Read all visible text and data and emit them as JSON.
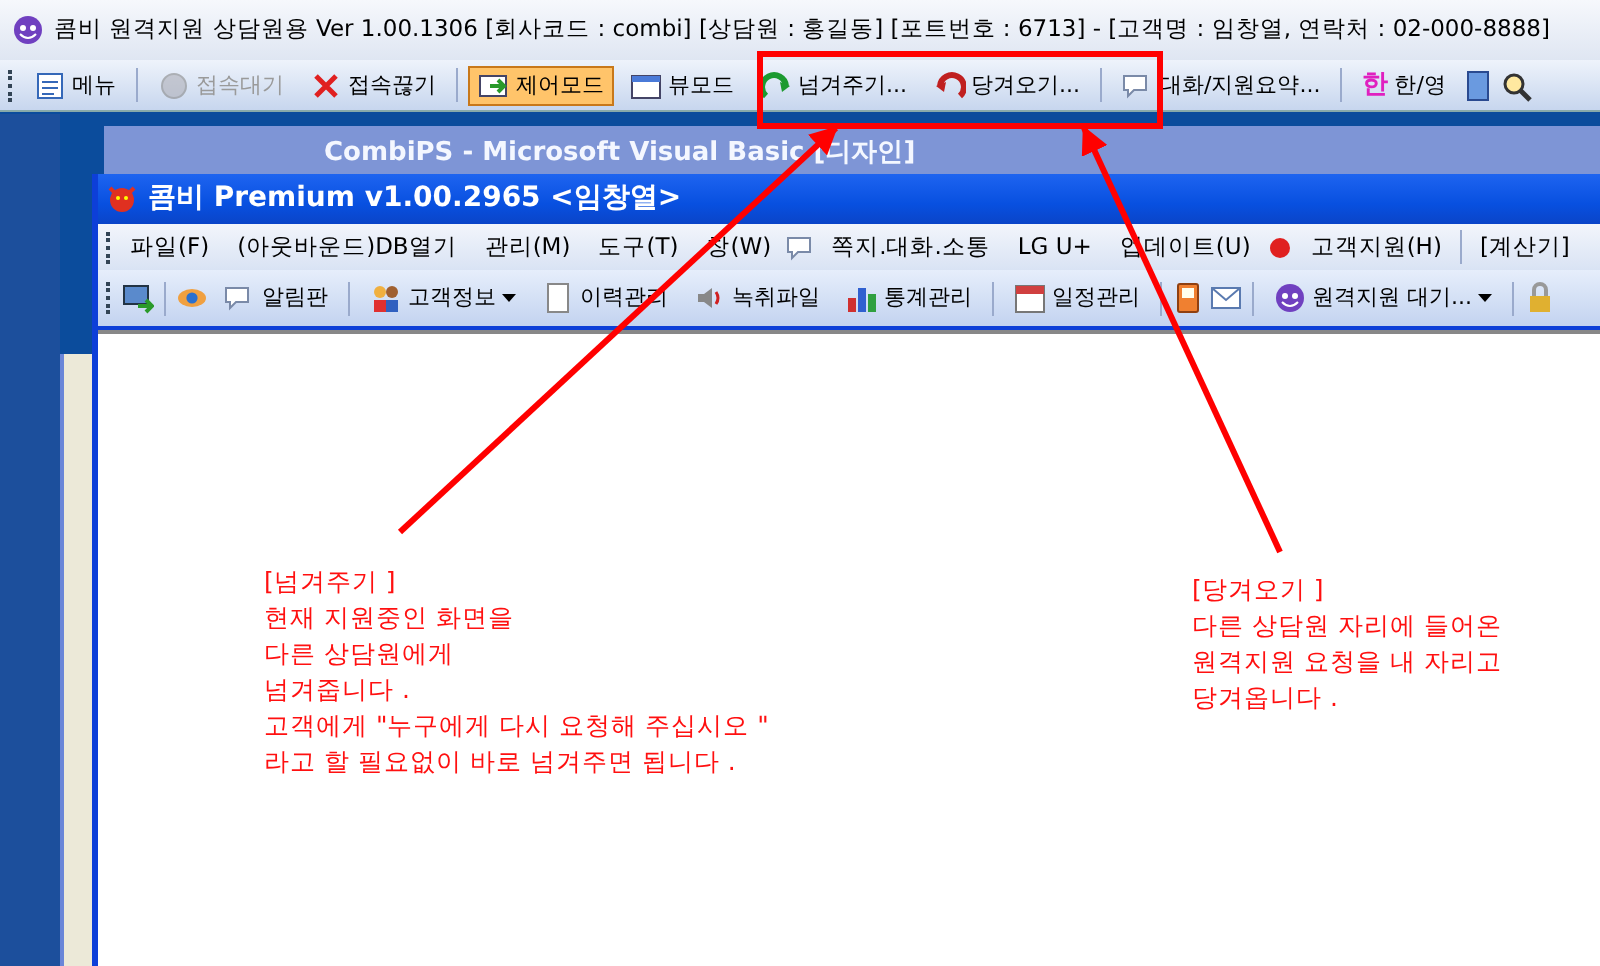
{
  "window": {
    "title": "콤비 원격지원 상담원용 Ver 1.00.1306 [회사코드 : combi] [상담원 : 홍길동] [포트번호 : 6713] - [고객명 : 임창열, 연락처 : 02-000-8888]"
  },
  "toolbar": [
    {
      "kind": "button",
      "label": "메뉴",
      "disabled": false,
      "selected": false
    },
    {
      "kind": "separator"
    },
    {
      "kind": "button",
      "label": "접속대기",
      "disabled": true,
      "selected": false
    },
    {
      "kind": "button",
      "label": "접속끊기",
      "disabled": false,
      "selected": false
    },
    {
      "kind": "separator"
    },
    {
      "kind": "button",
      "label": "제어모드",
      "disabled": false,
      "selected": true
    },
    {
      "kind": "button",
      "label": "뷰모드",
      "disabled": false,
      "selected": false
    },
    {
      "kind": "button",
      "label": "넘겨주기...",
      "disabled": false,
      "selected": false
    },
    {
      "kind": "button",
      "label": "당겨오기...",
      "disabled": false,
      "selected": false
    },
    {
      "kind": "separator"
    },
    {
      "kind": "button",
      "label": "대화/지원요약...",
      "disabled": false,
      "selected": false
    },
    {
      "kind": "separator"
    },
    {
      "kind": "lang",
      "glyph": "한",
      "label": "한/영",
      "disabled": false,
      "selected": false
    },
    {
      "kind": "icon"
    },
    {
      "kind": "icon"
    }
  ],
  "background_window": {
    "title": "CombiPS - Microsoft Visual Basic [디자인]"
  },
  "app_window": {
    "title": "콤비 Premium v1.00.2965 <임창열>",
    "menu": [
      "파일(F)",
      "(아웃바운드)DB열기",
      "관리(M)",
      "도구(T)",
      "창(W)",
      "쪽지.대화.소통",
      "LG U+",
      "업데이트(U)",
      "고객지원(H)",
      "[계산기]"
    ],
    "toolbar": [
      {
        "kind": "icon"
      },
      {
        "kind": "separator"
      },
      {
        "kind": "icon"
      },
      {
        "kind": "button",
        "label": "알림판"
      },
      {
        "kind": "separator"
      },
      {
        "kind": "dropdown",
        "label": "고객정보"
      },
      {
        "kind": "button",
        "label": "이력관리"
      },
      {
        "kind": "button",
        "label": "녹취파일"
      },
      {
        "kind": "button",
        "label": "통계관리"
      },
      {
        "kind": "separator"
      },
      {
        "kind": "button",
        "label": "일정관리"
      },
      {
        "kind": "separator"
      },
      {
        "kind": "icon"
      },
      {
        "kind": "icon"
      },
      {
        "kind": "separator"
      },
      {
        "kind": "dropdown",
        "label": "원격지원 대기..."
      },
      {
        "kind": "separator"
      },
      {
        "kind": "icon"
      }
    ]
  },
  "annotations": [
    {
      "heading": "[넘겨주기 ]",
      "lines": [
        "현재 지원중인 화면을",
        "다른 상담원에게",
        "넘겨줍니다 .",
        "고객에게 \"누구에게 다시 요청해 주십시오 \"",
        "라고 할 필요없이 바로 넘겨주면 됩니다 ."
      ]
    },
    {
      "heading": "[당겨오기 ]",
      "lines": [
        "다른 상담원 자리에 들어온",
        "원격지원 요청을 내 자리고",
        "당겨옵니다 ."
      ]
    }
  ]
}
